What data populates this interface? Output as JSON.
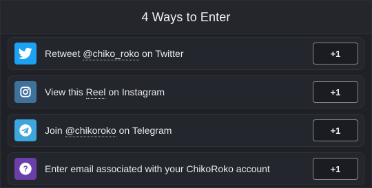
{
  "header": {
    "title": "4 Ways to Enter"
  },
  "entries": [
    {
      "icon": "twitter-icon",
      "color": "#1da1f2",
      "label_prefix": "Retweet ",
      "label_link": "@chiko_roko",
      "label_suffix": " on Twitter",
      "points": "+1"
    },
    {
      "icon": "instagram-icon",
      "color": "#3f729b",
      "label_prefix": "View this ",
      "label_link": "Reel",
      "label_suffix": " on Instagram",
      "points": "+1"
    },
    {
      "icon": "telegram-icon",
      "color": "#3da6dc",
      "label_prefix": "Join ",
      "label_link": "@chikoroko",
      "label_suffix": " on Telegram",
      "points": "+1"
    },
    {
      "icon": "question-icon",
      "color": "#6b3fa8",
      "label": "Enter email associated with your ChikoRoko account",
      "points": "+1"
    }
  ]
}
